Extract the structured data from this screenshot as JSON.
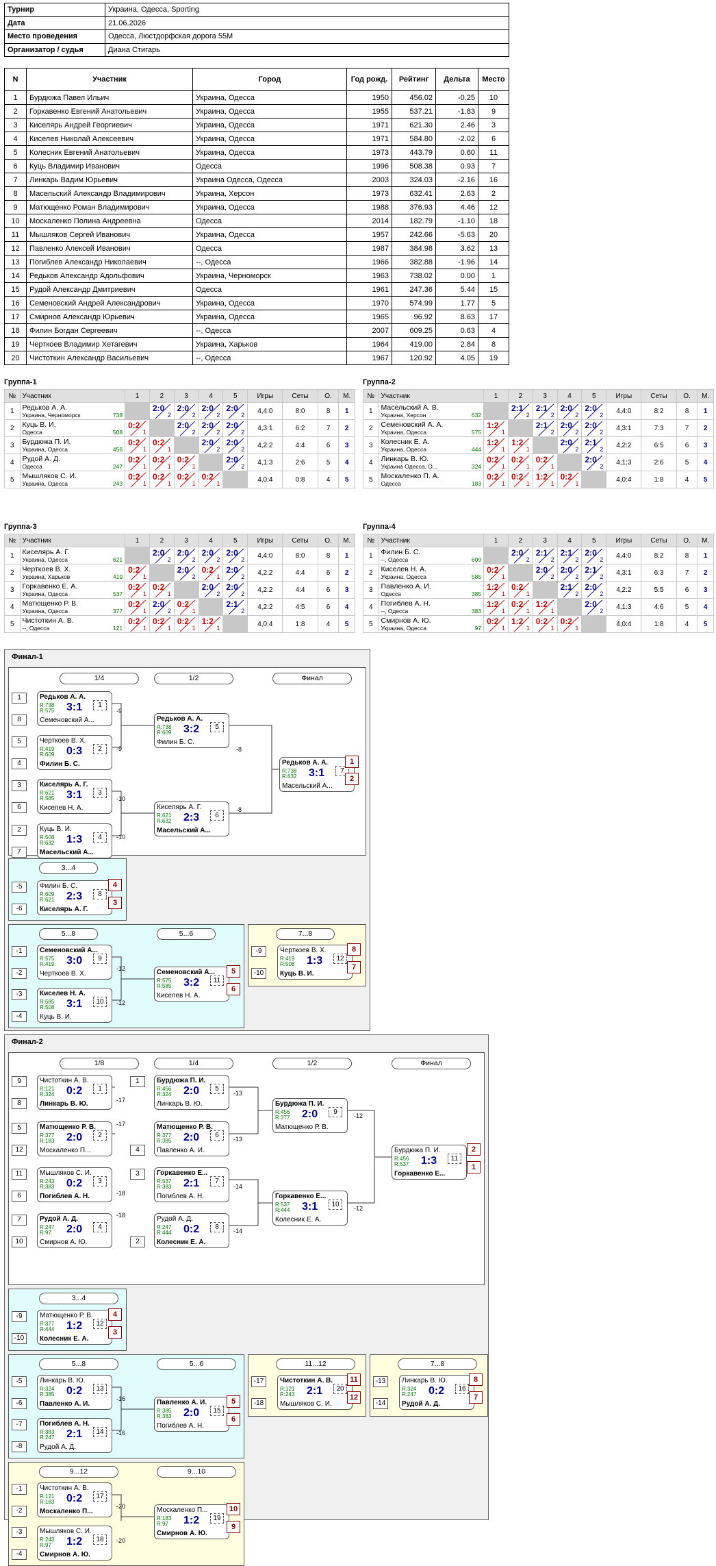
{
  "info": [
    {
      "k": "Турнир",
      "v": "Украина, Одесса, Sporting"
    },
    {
      "k": "Дата",
      "v": "21.06.2026"
    },
    {
      "k": "Место проведения",
      "v": "Одесса, Люстдорфская дорога 55М"
    },
    {
      "k": "Организатор / судья",
      "v": "Диана Стигарь"
    }
  ],
  "plist": {
    "headers": [
      "N",
      "Участник",
      "Город",
      "Год рожд.",
      "Рейтинг",
      "Дельта",
      "Место"
    ],
    "rows": [
      [
        "1",
        "Бурдюжа Павел Ильич",
        "Украина, Одесса",
        "1950",
        "456.02",
        "-0.25",
        "10"
      ],
      [
        "2",
        "Горкавенко Евгений Анатольевич",
        "Украина, Одесса",
        "1955",
        "537.21",
        "-1.83",
        "9"
      ],
      [
        "3",
        "Киселярь Андрей Георгиевич",
        "Украина, Одесса",
        "1971",
        "621.30",
        "2.46",
        "3"
      ],
      [
        "4",
        "Киселев Николай Алексеевич",
        "Украина, Одесса",
        "1971",
        "584.80",
        "-2.02",
        "6"
      ],
      [
        "5",
        "Колесник Евгений Анатольевич",
        "Украина, Одесса",
        "1973",
        "443.79",
        "0.60",
        "11"
      ],
      [
        "6",
        "Куць Владимир Иванович",
        "Одесса",
        "1996",
        "508.38",
        "0.93",
        "7"
      ],
      [
        "7",
        "Линкарь Вадим Юрьевич",
        "Украина Одесса, Одесса",
        "2003",
        "324.03",
        "-2.16",
        "16"
      ],
      [
        "8",
        "Масельский Александр Владимирович",
        "Украина, Херсон",
        "1973",
        "632.41",
        "2.63",
        "2"
      ],
      [
        "9",
        "Матющенко Роман Владимирович",
        "Украина, Одесса",
        "1988",
        "376.93",
        "4.46",
        "12"
      ],
      [
        "10",
        "Москаленко Полина Андреевна",
        "Одесса",
        "2014",
        "182.79",
        "-1.10",
        "18"
      ],
      [
        "11",
        "Мышляков Сергей Иванович",
        "Украина, Одесса",
        "1957",
        "242.66",
        "-5.63",
        "20"
      ],
      [
        "12",
        "Павленко Алексей Иванович",
        "Одесса",
        "1987",
        "384.98",
        "3.62",
        "13"
      ],
      [
        "13",
        "Погиблев Александр Николаевич",
        "--, Одесса",
        "1966",
        "382.88",
        "-1.96",
        "14"
      ],
      [
        "14",
        "Редьков Александр Адольфович",
        "Украина, Черноморск",
        "1963",
        "738.02",
        "0.00",
        "1"
      ],
      [
        "15",
        "Рудой Александр Дмитриевич",
        "Одесса",
        "1961",
        "247.36",
        "5.44",
        "15"
      ],
      [
        "16",
        "Семеновский Андрей Александрович",
        "Украина, Одесса",
        "1970",
        "574.99",
        "1.77",
        "5"
      ],
      [
        "17",
        "Смирнов Александр Юрьевич",
        "Украина, Одесса",
        "1965",
        "96.92",
        "8.63",
        "17"
      ],
      [
        "18",
        "Филин Богдан Сергеевич",
        "--, Одесса",
        "2007",
        "609.25",
        "0.63",
        "4"
      ],
      [
        "19",
        "Черткоев Владимир Хетагевич",
        "Украина, Харьков",
        "1964",
        "419.00",
        "2.84",
        "8"
      ],
      [
        "20",
        "Чистоткин Александр Васильевич",
        "--, Одесса",
        "1967",
        "120.92",
        "4.05",
        "19"
      ]
    ]
  },
  "group_headers": [
    "№",
    "Участник",
    "1",
    "2",
    "3",
    "4",
    "5",
    "Игры",
    "Сеты",
    "О.",
    "М."
  ],
  "groups": [
    {
      "title": "Группа-1",
      "rows": [
        {
          "n": "1",
          "name": "Редьков А. А.",
          "city": "Украина, Черноморск",
          "r": "738",
          "res": [
            "x",
            "2:0/2",
            "2:0/2",
            "2:0/2",
            "2:0/2"
          ],
          "games": "4,4:0",
          "sets": "8:0",
          "pts": "8",
          "place": "1"
        },
        {
          "n": "2",
          "name": "Куць В. И.",
          "city": "Одесса",
          "r": "508",
          "res": [
            "0:2/1",
            "x",
            "2:0/2",
            "2:0/2",
            "2:0/2"
          ],
          "games": "4,3:1",
          "sets": "6:2",
          "pts": "7",
          "place": "2"
        },
        {
          "n": "3",
          "name": "Бурдюжа П. И.",
          "city": "Украина, Одесса",
          "r": "456",
          "res": [
            "0:2/1",
            "0:2/1",
            "x",
            "2:0/2",
            "2:0/2"
          ],
          "games": "4,2:2",
          "sets": "4:4",
          "pts": "6",
          "place": "3"
        },
        {
          "n": "4",
          "name": "Рудой А. Д.",
          "city": "Одесса",
          "r": "247",
          "res": [
            "0:2/1",
            "0:2/1",
            "0:2/1",
            "x",
            "2:0/2"
          ],
          "games": "4,1:3",
          "sets": "2:6",
          "pts": "5",
          "place": "4"
        },
        {
          "n": "5",
          "name": "Мышляков С. И.",
          "city": "Украина, Одесса",
          "r": "243",
          "res": [
            "0:2/1",
            "0:2/1",
            "0:2/1",
            "0:2/1",
            "x"
          ],
          "games": "4,0:4",
          "sets": "0:8",
          "pts": "4",
          "place": "5"
        }
      ]
    },
    {
      "title": "Группа-2",
      "rows": [
        {
          "n": "1",
          "name": "Масельский А. В.",
          "city": "Украина, Херсон",
          "r": "632",
          "res": [
            "x",
            "2:1/2",
            "2:1/2",
            "2:0/2",
            "2:0/2"
          ],
          "games": "4,4:0",
          "sets": "8:2",
          "pts": "8",
          "place": "1"
        },
        {
          "n": "2",
          "name": "Семеновский А. А.",
          "city": "Украина, Одесса",
          "r": "575",
          "res": [
            "1:2/1",
            "x",
            "2:1/2",
            "2:0/2",
            "2:0/2"
          ],
          "games": "4,3:1",
          "sets": "7:3",
          "pts": "7",
          "place": "2"
        },
        {
          "n": "3",
          "name": "Колесник Е. А.",
          "city": "Украина, Одесса",
          "r": "444",
          "res": [
            "1:2/1",
            "1:2/1",
            "x",
            "2:0/2",
            "2:1/2"
          ],
          "games": "4,2:2",
          "sets": "6:5",
          "pts": "6",
          "place": "3"
        },
        {
          "n": "4",
          "name": "Линкарь В. Ю.",
          "city": "Украина Одесса, О...",
          "r": "324",
          "res": [
            "0:2/1",
            "0:2/1",
            "0:2/1",
            "x",
            "2:0/2"
          ],
          "games": "4,1:3",
          "sets": "2:6",
          "pts": "5",
          "place": "4"
        },
        {
          "n": "5",
          "name": "Москаленко П. А.",
          "city": "Одесса",
          "r": "183",
          "res": [
            "0:2/1",
            "0:2/1",
            "1:2/1",
            "0:2/1",
            "x"
          ],
          "games": "4,0:4",
          "sets": "1:8",
          "pts": "4",
          "place": "5"
        }
      ]
    },
    {
      "title": "Группа-3",
      "rows": [
        {
          "n": "1",
          "name": "Киселярь А. Г.",
          "city": "Украина, Одесса",
          "r": "621",
          "res": [
            "x",
            "2:0/2",
            "2:0/2",
            "2:0/2",
            "2:0/2"
          ],
          "games": "4,4:0",
          "sets": "8:0",
          "pts": "8",
          "place": "1"
        },
        {
          "n": "2",
          "name": "Черткоев В. Х.",
          "city": "Украина, Харьков",
          "r": "419",
          "res": [
            "0:2/1",
            "x",
            "2:0/2",
            "0:2/1",
            "2:0/2"
          ],
          "games": "4,2:2",
          "sets": "4:4",
          "pts": "6",
          "place": "2"
        },
        {
          "n": "3",
          "name": "Горкавенко Е. А.",
          "city": "Украина, Одесса",
          "r": "537",
          "res": [
            "0:2/1",
            "0:2/1",
            "x",
            "2:0/2",
            "2:0/2"
          ],
          "games": "4,2:2",
          "sets": "4:4",
          "pts": "6",
          "place": "3"
        },
        {
          "n": "4",
          "name": "Матющенко Р. В.",
          "city": "Украина, Одесса",
          "r": "377",
          "res": [
            "0:2/1",
            "2:0/2",
            "0:2/1",
            "x",
            "2:1/2"
          ],
          "games": "4,2:2",
          "sets": "4:5",
          "pts": "6",
          "place": "4"
        },
        {
          "n": "5",
          "name": "Чистоткин А. В.",
          "city": "--, Одесса",
          "r": "121",
          "res": [
            "0:2/1",
            "0:2/1",
            "0:2/1",
            "1:2/1",
            "x"
          ],
          "games": "4,0:4",
          "sets": "1:8",
          "pts": "4",
          "place": "5"
        }
      ]
    },
    {
      "title": "Группа-4",
      "rows": [
        {
          "n": "1",
          "name": "Филин Б. С.",
          "city": "--, Одесса",
          "r": "609",
          "res": [
            "x",
            "2:0/2",
            "2:1/2",
            "2:1/2",
            "2:0/2"
          ],
          "games": "4,4:0",
          "sets": "8:2",
          "pts": "8",
          "place": "1"
        },
        {
          "n": "2",
          "name": "Киселев Н. А.",
          "city": "Украина, Одесса",
          "r": "585",
          "res": [
            "0:2/1",
            "x",
            "2:0/2",
            "2:0/2",
            "2:1/2"
          ],
          "games": "4,3:1",
          "sets": "6:3",
          "pts": "7",
          "place": "2"
        },
        {
          "n": "3",
          "name": "Павленко А. И.",
          "city": "Одесса",
          "r": "385",
          "res": [
            "1:2/1",
            "0:2/1",
            "x",
            "2:1/2",
            "2:0/2"
          ],
          "games": "4,2:2",
          "sets": "5:5",
          "pts": "6",
          "place": "3"
        },
        {
          "n": "4",
          "name": "Погиблев А. Н.",
          "city": "--, Одесса",
          "r": "383",
          "res": [
            "1:2/1",
            "0:2/1",
            "1:2/1",
            "x",
            "2:0/2"
          ],
          "games": "4,1:3",
          "sets": "4:6",
          "pts": "5",
          "place": "4"
        },
        {
          "n": "5",
          "name": "Смирнов А. Ю.",
          "city": "Украина, Одесса",
          "r": "97",
          "res": [
            "0:2/1",
            "1:2/1",
            "0:2/1",
            "0:2/1",
            "x"
          ],
          "games": "4,0:4",
          "sets": "1:8",
          "pts": "4",
          "place": "5"
        }
      ]
    }
  ],
  "final1": {
    "title": "Финал-1",
    "stage_labels": [
      "1/4",
      "1/2",
      "Финал",
      "3...4",
      "5...8",
      "5...6",
      "7...8"
    ],
    "seeds": [
      "1",
      "8",
      "5",
      "4",
      "3",
      "6",
      "2",
      "7",
      "-5",
      "-6",
      "-1",
      "-2",
      "-3",
      "-4",
      "-9",
      "-10"
    ],
    "refs": [
      "-9",
      "-9",
      "-10",
      "-10",
      "-8",
      "-8",
      "-12",
      "-12"
    ],
    "places": [
      "1",
      "2",
      "4",
      "3",
      "5",
      "6",
      "8",
      "7"
    ],
    "matches": [
      {
        "p1": "Редьков А. А.",
        "p2": "Семеновский А...",
        "r1": "R:738",
        "r2": "R:575",
        "score": "3:1",
        "no": "1",
        "w": 1
      },
      {
        "p1": "Черткоев В. Х.",
        "p2": "Филин Б. С.",
        "r1": "R:419",
        "r2": "R:609",
        "score": "0:3",
        "no": "2",
        "w": 2
      },
      {
        "p1": "Киселярь А. Г.",
        "p2": "Киселев Н. А.",
        "r1": "R:621",
        "r2": "R:585",
        "score": "3:1",
        "no": "3",
        "w": 1
      },
      {
        "p1": "Куць В. И.",
        "p2": "Масельский А...",
        "r1": "R:508",
        "r2": "R:632",
        "score": "1:3",
        "no": "4",
        "w": 2
      },
      {
        "p1": "Редьков А. А.",
        "p2": "Филин Б. С.",
        "r1": "R:738",
        "r2": "R:609",
        "score": "3:2",
        "no": "5",
        "w": 1
      },
      {
        "p1": "Киселярь А. Г.",
        "p2": "Масельский А...",
        "r1": "R:621",
        "r2": "R:632",
        "score": "2:3",
        "no": "6",
        "w": 2
      },
      {
        "p1": "Редьков А. А.",
        "p2": "Масельский А...",
        "r1": "R:738",
        "r2": "R:632",
        "score": "3:1",
        "no": "7",
        "w": 1
      },
      {
        "p1": "Филин Б. С.",
        "p2": "Киселярь А. Г.",
        "r1": "R:609",
        "r2": "R:621",
        "score": "2:3",
        "no": "8",
        "w": 2
      },
      {
        "p1": "Семеновский А...",
        "p2": "Черткоев В. Х.",
        "r1": "R:575",
        "r2": "R:419",
        "score": "3:0",
        "no": "9",
        "w": 1
      },
      {
        "p1": "Киселев Н. А.",
        "p2": "Куць В. И.",
        "r1": "R:585",
        "r2": "R:508",
        "score": "3:1",
        "no": "10",
        "w": 1
      },
      {
        "p1": "Семеновский А...",
        "p2": "Киселев Н. А.",
        "r1": "R:575",
        "r2": "R:585",
        "score": "3:2",
        "no": "11",
        "w": 1
      },
      {
        "p1": "Черткоев В. Х.",
        "p2": "Куць В. И.",
        "r1": "R:419",
        "r2": "R:508",
        "score": "1:3",
        "no": "12",
        "w": 2
      }
    ]
  },
  "final2": {
    "title": "Финал-2",
    "stage_labels": [
      "1/8",
      "1/4",
      "1/2",
      "Финал",
      "3...4",
      "5...8",
      "5...6",
      "11...12",
      "7...8",
      "9...12",
      "9...10"
    ],
    "seeds": [
      "9",
      "8",
      "5",
      "12",
      "11",
      "6",
      "7",
      "10",
      "1",
      "4",
      "3",
      "2",
      "-9",
      "-10",
      "-5",
      "-6",
      "-7",
      "-8",
      "-17",
      "-18",
      "-13",
      "-14",
      "-1",
      "-2",
      "-3",
      "-4"
    ],
    "refs": [
      "-17",
      "-17",
      "-18",
      "-18",
      "-13",
      "-13",
      "-14",
      "-14",
      "-12",
      "-12",
      "-16",
      "-16",
      "-20",
      "-20"
    ],
    "places": [
      "2",
      "1",
      "4",
      "3",
      "5",
      "6",
      "11",
      "12",
      "8",
      "7",
      "10",
      "9"
    ],
    "matches": [
      {
        "p1": "Чистоткин А. В.",
        "p2": "Линкарь В. Ю.",
        "r1": "R:121",
        "r2": "R:324",
        "score": "0:2",
        "no": "1",
        "w": 2
      },
      {
        "p1": "Матющенко Р. В.",
        "p2": "Москаленко П...",
        "r1": "R:377",
        "r2": "R:183",
        "score": "2:0",
        "no": "2",
        "w": 1
      },
      {
        "p1": "Мышляков С. И.",
        "p2": "Погиблев А. Н.",
        "r1": "R:243",
        "r2": "R:383",
        "score": "0:2",
        "no": "3",
        "w": 2
      },
      {
        "p1": "Рудой А. Д.",
        "p2": "Смирнов А. Ю.",
        "r1": "R:247",
        "r2": "R:97",
        "score": "2:0",
        "no": "4",
        "w": 1
      },
      {
        "p1": "Бурдюжа П. И.",
        "p2": "Линкарь В. Ю.",
        "r1": "R:456",
        "r2": "R:324",
        "score": "2:0",
        "no": "5",
        "w": 1
      },
      {
        "p1": "Матющенко Р. В.",
        "p2": "Павленко А. И.",
        "r1": "R:377",
        "r2": "R:385",
        "score": "2:0",
        "no": "6",
        "w": 1
      },
      {
        "p1": "Горкавенко Е...",
        "p2": "Погиблев А. Н.",
        "r1": "R:537",
        "r2": "R:383",
        "score": "2:1",
        "no": "7",
        "w": 1
      },
      {
        "p1": "Рудой А. Д.",
        "p2": "Колесник Е. А.",
        "r1": "R:247",
        "r2": "R:444",
        "score": "0:2",
        "no": "8",
        "w": 2
      },
      {
        "p1": "Бурдюжа П. И.",
        "p2": "Матющенко Р. В.",
        "r1": "R:456",
        "r2": "R:377",
        "score": "2:0",
        "no": "9",
        "w": 1
      },
      {
        "p1": "Горкавенко Е...",
        "p2": "Колесник Е. А.",
        "r1": "R:537",
        "r2": "R:444",
        "score": "3:1",
        "no": "10",
        "w": 1
      },
      {
        "p1": "Бурдюжа П. И.",
        "p2": "Горкавенко Е...",
        "r1": "R:456",
        "r2": "R:537",
        "score": "1:3",
        "no": "11",
        "w": 2
      },
      {
        "p1": "Матющенко Р. В.",
        "p2": "Колесник Е. А.",
        "r1": "R:377",
        "r2": "R:444",
        "score": "1:2",
        "no": "12",
        "w": 2
      },
      {
        "p1": "Линкарь В. Ю.",
        "p2": "Павленко А. И.",
        "r1": "R:324",
        "r2": "R:385",
        "score": "0:2",
        "no": "13",
        "w": 2
      },
      {
        "p1": "Погиблев А. Н.",
        "p2": "Рудой А. Д.",
        "r1": "R:383",
        "r2": "R:247",
        "score": "2:1",
        "no": "14",
        "w": 1
      },
      {
        "p1": "Павленко А. И.",
        "p2": "Погиблев А. Н.",
        "r1": "R:385",
        "r2": "R:383",
        "score": "2:0",
        "no": "15",
        "w": 1
      },
      {
        "p1": "Линкарь В. Ю.",
        "p2": "Рудой А. Д.",
        "r1": "R:324",
        "r2": "R:247",
        "score": "0:2",
        "no": "16",
        "w": 2
      },
      {
        "p1": "Чистоткин А. В.",
        "p2": "Москаленко П...",
        "r1": "R:121",
        "r2": "R:183",
        "score": "0:2",
        "no": "17",
        "w": 2
      },
      {
        "p1": "Мышляков С. И.",
        "p2": "Смирнов А. Ю.",
        "r1": "R:243",
        "r2": "R:97",
        "score": "1:2",
        "no": "18",
        "w": 2
      },
      {
        "p1": "Москаленко П...",
        "p2": "Смирнов А. Ю.",
        "r1": "R:183",
        "r2": "R:97",
        "score": "1:2",
        "no": "19",
        "w": 2
      },
      {
        "p1": "Чистоткин А. В.",
        "p2": "Мышляков С. И.",
        "r1": "R:121",
        "r2": "R:243",
        "score": "2:1",
        "no": "20",
        "w": 1
      }
    ]
  }
}
